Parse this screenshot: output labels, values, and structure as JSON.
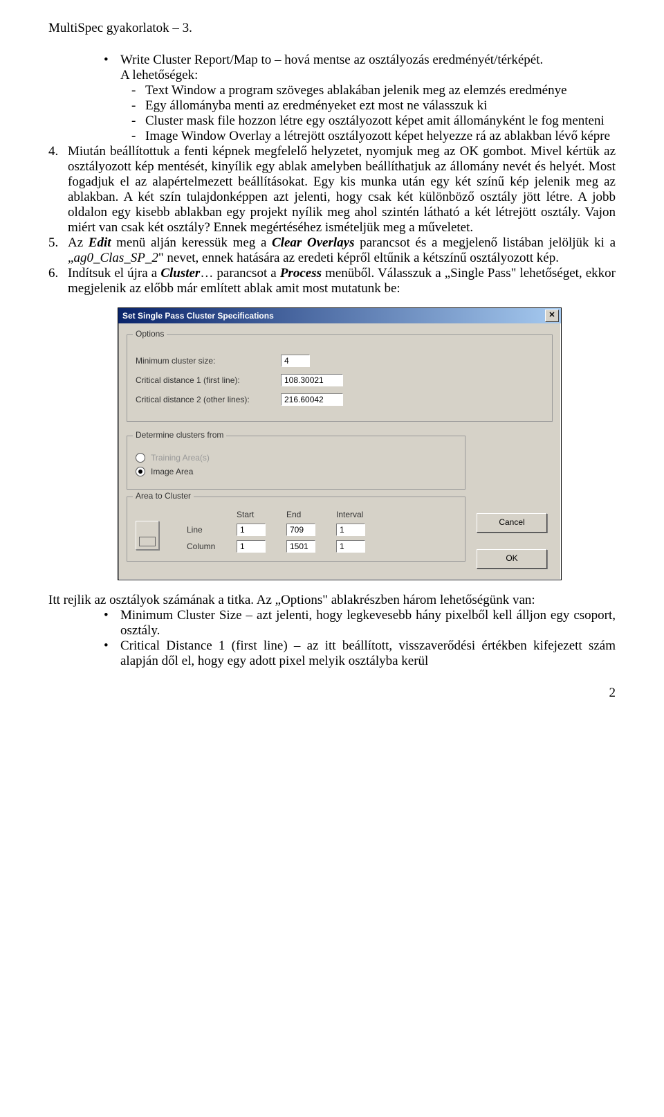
{
  "header": "MultiSpec gyakorlatok – 3.",
  "intro_bullet": "Write Cluster Report/Map to – hová mentse az osztályozás eredményét/térképét.",
  "sub_intro": "A lehetőségek:",
  "subs": [
    "Text Window a program szöveges ablakában jelenik meg az elemzés eredménye",
    "Egy állományba menti az eredményeket ezt most ne válasszuk ki",
    "Cluster mask file hozzon létre egy osztályozott képet amit állományként le fog menteni",
    "Image Window Overlay a létrejött osztályozott képet helyezze rá az ablakban lévő képre"
  ],
  "items": [
    {
      "num": "4.",
      "text_before": "Miután beállítottuk a fenti képnek megfelelő helyzetet, nyomjuk meg az OK gombot. Mivel kértük az osztályozott kép mentését, kinyílik egy ablak amelyben beállíthatjuk az állomány nevét és helyét. Most fogadjuk el az alapértelmezett beállításokat. Egy kis munka után egy két színű kép jelenik meg az ablakban. A két szín tulajdonképpen azt jelenti, hogy csak két különböző osztály jött létre. A jobb oldalon egy kisebb ablakban egy projekt nyílik meg ahol szintén látható a két létrejött osztály. Vajon miért van csak két osztály? Ennek megértéséhez ismételjük meg a műveletet."
    },
    {
      "num": "5.",
      "text_a": "Az ",
      "em1": "Edit",
      "text_b": " menü alján keressük meg a ",
      "em2": "Clear Overlays",
      "text_c": " parancsot és a megjelenő listában jelöljük ki a „",
      "em3": "ag0_Clas_SP_2",
      "text_d": "\" nevet, ennek hatására az eredeti képről eltűnik a kétszínű osztályozott kép."
    },
    {
      "num": "6.",
      "text_a": "Indítsuk el újra a ",
      "em1": "Cluster",
      "text_b": "… parancsot a ",
      "em2": "Process",
      "text_c": " menüből. Válasszuk a „Single Pass\" lehetőséget, ekkor megjelenik az előbb már említett ablak amit most mutatunk be:"
    }
  ],
  "dialog": {
    "title": "Set Single Pass Cluster Specifications",
    "options_label": "Options",
    "min_cluster_label": "Minimum cluster size:",
    "min_cluster_value": "4",
    "cd1_label": "Critical distance 1 (first line):",
    "cd1_value": "108.30021",
    "cd2_label": "Critical distance 2 (other lines):",
    "cd2_value": "216.60042",
    "determine_label": "Determine clusters from",
    "radio_training": "Training Area(s)",
    "radio_image": "Image Area",
    "area_label": "Area to Cluster",
    "col_start": "Start",
    "col_end": "End",
    "col_interval": "Interval",
    "row_line": "Line",
    "row_column": "Column",
    "line_start": "1",
    "line_end": "709",
    "line_interval": "1",
    "col_start_v": "1",
    "col_end_v": "1501",
    "col_interval_v": "1",
    "cancel": "Cancel",
    "ok": "OK"
  },
  "after_para": "Itt rejlik az osztályok számának a titka. Az „Options\" ablakrészben három lehetőségünk van:",
  "after_bullets": [
    "Minimum Cluster Size – azt jelenti, hogy legkevesebb hány pixelből kell álljon egy csoport, osztály.",
    "Critical Distance 1 (first line) – az itt beállított, visszaverődési értékben kifejezett szám alapján dől el, hogy egy adott pixel melyik osztályba kerül"
  ],
  "page_num": "2"
}
